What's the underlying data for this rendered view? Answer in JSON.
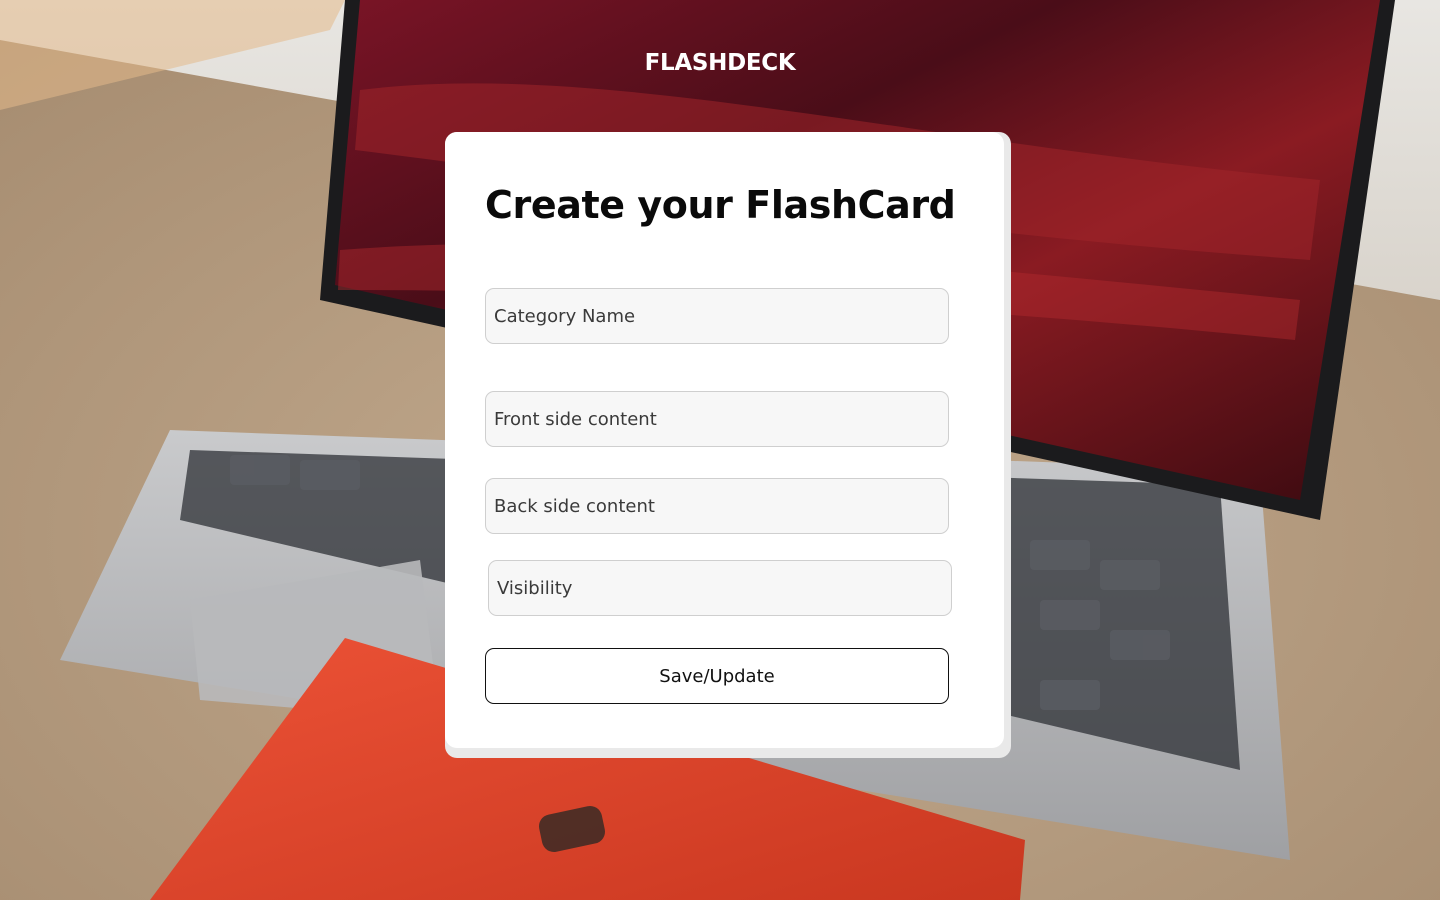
{
  "header": {
    "brand": "FLASHDECK"
  },
  "form": {
    "title": "Create your FlashCard",
    "fields": [
      {
        "name": "category",
        "placeholder": "Category Name",
        "value": ""
      },
      {
        "name": "front",
        "placeholder": "Front side content",
        "value": ""
      },
      {
        "name": "back",
        "placeholder": "Back side content",
        "value": ""
      },
      {
        "name": "visibility",
        "placeholder": "Visibility",
        "value": ""
      }
    ],
    "submit_label": "Save/Update"
  },
  "colors": {
    "card_bg": "#ffffff",
    "field_bg": "#f7f7f7",
    "field_border": "#cfcfcf",
    "button_border": "#111111",
    "brand_text": "#ffffff",
    "notebook_red": "#e0452c",
    "screen_red": "#5a0f1a"
  },
  "background": {
    "description_icon": "laptop-with-red-notebook-photo"
  }
}
